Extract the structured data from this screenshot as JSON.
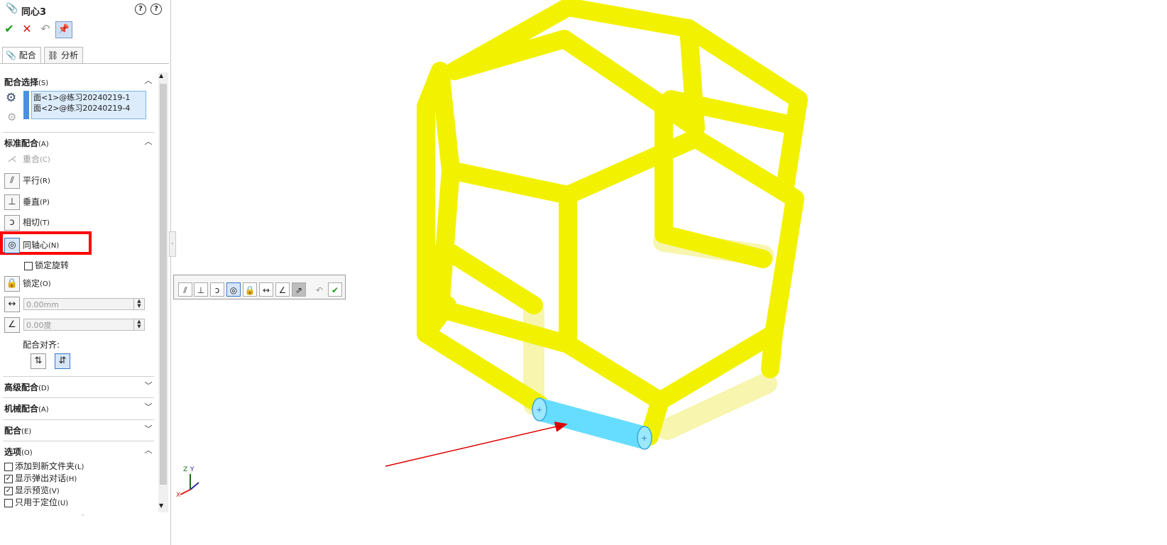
{
  "panel": {
    "title": "同心3",
    "tabs": [
      {
        "label": "配合"
      },
      {
        "label": "分析"
      }
    ],
    "mate_selection": {
      "title": "配合选择",
      "hotkey": "(S)",
      "items": [
        "面<1>@练习20240219-1",
        "面<2>@练习20240219-4"
      ]
    },
    "standard_mates": {
      "title": "标准配合",
      "hotkey": "(A)",
      "coincident": {
        "label": "重合",
        "hotkey": "(C)"
      },
      "parallel": {
        "label": "平行",
        "hotkey": "(R)"
      },
      "perpendicular": {
        "label": "垂直",
        "hotkey": "(P)"
      },
      "tangent": {
        "label": "相切",
        "hotkey": "(T)"
      },
      "concentric": {
        "label": "同轴心",
        "hotkey": "(N)"
      },
      "lock_rotation": {
        "label": "锁定旋转",
        "checked": false
      },
      "lock": {
        "label": "锁定",
        "hotkey": "(O)"
      },
      "distance_value": "0.00mm",
      "angle_value": "0.00度",
      "alignment_label": "配合对齐:"
    },
    "advanced": {
      "title": "高级配合",
      "hotkey": "(D)"
    },
    "mechanical": {
      "title": "机械配合",
      "hotkey": "(A)"
    },
    "mates": {
      "title": "配合",
      "hotkey": "(E)"
    },
    "options": {
      "title": "选项",
      "hotkey": "(O)",
      "items": [
        {
          "label": "添加到新文件夹",
          "hotkey": "(L)",
          "checked": false
        },
        {
          "label": "显示弹出对话",
          "hotkey": "(H)",
          "checked": true
        },
        {
          "label": "显示预览",
          "hotkey": "(V)",
          "checked": true
        },
        {
          "label": "只用于定位",
          "hotkey": "(U)",
          "checked": false
        }
      ]
    }
  },
  "triad": {
    "z": "Z",
    "y": "Y",
    "x": "X"
  },
  "colors": {
    "model": "#f2f200",
    "selected": "#66ddff",
    "highlight": "#ff0000",
    "arrow": "#dd0000"
  }
}
